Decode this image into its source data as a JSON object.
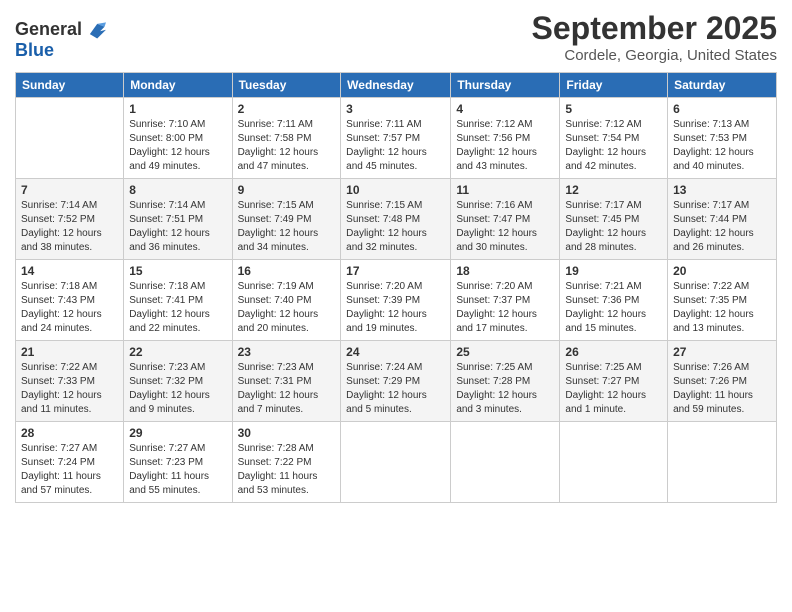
{
  "header": {
    "logo_general": "General",
    "logo_blue": "Blue",
    "month_title": "September 2025",
    "location": "Cordele, Georgia, United States"
  },
  "calendar": {
    "days_of_week": [
      "Sunday",
      "Monday",
      "Tuesday",
      "Wednesday",
      "Thursday",
      "Friday",
      "Saturday"
    ],
    "weeks": [
      [
        {
          "day": "",
          "info": ""
        },
        {
          "day": "1",
          "info": "Sunrise: 7:10 AM\nSunset: 8:00 PM\nDaylight: 12 hours\nand 49 minutes."
        },
        {
          "day": "2",
          "info": "Sunrise: 7:11 AM\nSunset: 7:58 PM\nDaylight: 12 hours\nand 47 minutes."
        },
        {
          "day": "3",
          "info": "Sunrise: 7:11 AM\nSunset: 7:57 PM\nDaylight: 12 hours\nand 45 minutes."
        },
        {
          "day": "4",
          "info": "Sunrise: 7:12 AM\nSunset: 7:56 PM\nDaylight: 12 hours\nand 43 minutes."
        },
        {
          "day": "5",
          "info": "Sunrise: 7:12 AM\nSunset: 7:54 PM\nDaylight: 12 hours\nand 42 minutes."
        },
        {
          "day": "6",
          "info": "Sunrise: 7:13 AM\nSunset: 7:53 PM\nDaylight: 12 hours\nand 40 minutes."
        }
      ],
      [
        {
          "day": "7",
          "info": "Sunrise: 7:14 AM\nSunset: 7:52 PM\nDaylight: 12 hours\nand 38 minutes."
        },
        {
          "day": "8",
          "info": "Sunrise: 7:14 AM\nSunset: 7:51 PM\nDaylight: 12 hours\nand 36 minutes."
        },
        {
          "day": "9",
          "info": "Sunrise: 7:15 AM\nSunset: 7:49 PM\nDaylight: 12 hours\nand 34 minutes."
        },
        {
          "day": "10",
          "info": "Sunrise: 7:15 AM\nSunset: 7:48 PM\nDaylight: 12 hours\nand 32 minutes."
        },
        {
          "day": "11",
          "info": "Sunrise: 7:16 AM\nSunset: 7:47 PM\nDaylight: 12 hours\nand 30 minutes."
        },
        {
          "day": "12",
          "info": "Sunrise: 7:17 AM\nSunset: 7:45 PM\nDaylight: 12 hours\nand 28 minutes."
        },
        {
          "day": "13",
          "info": "Sunrise: 7:17 AM\nSunset: 7:44 PM\nDaylight: 12 hours\nand 26 minutes."
        }
      ],
      [
        {
          "day": "14",
          "info": "Sunrise: 7:18 AM\nSunset: 7:43 PM\nDaylight: 12 hours\nand 24 minutes."
        },
        {
          "day": "15",
          "info": "Sunrise: 7:18 AM\nSunset: 7:41 PM\nDaylight: 12 hours\nand 22 minutes."
        },
        {
          "day": "16",
          "info": "Sunrise: 7:19 AM\nSunset: 7:40 PM\nDaylight: 12 hours\nand 20 minutes."
        },
        {
          "day": "17",
          "info": "Sunrise: 7:20 AM\nSunset: 7:39 PM\nDaylight: 12 hours\nand 19 minutes."
        },
        {
          "day": "18",
          "info": "Sunrise: 7:20 AM\nSunset: 7:37 PM\nDaylight: 12 hours\nand 17 minutes."
        },
        {
          "day": "19",
          "info": "Sunrise: 7:21 AM\nSunset: 7:36 PM\nDaylight: 12 hours\nand 15 minutes."
        },
        {
          "day": "20",
          "info": "Sunrise: 7:22 AM\nSunset: 7:35 PM\nDaylight: 12 hours\nand 13 minutes."
        }
      ],
      [
        {
          "day": "21",
          "info": "Sunrise: 7:22 AM\nSunset: 7:33 PM\nDaylight: 12 hours\nand 11 minutes."
        },
        {
          "day": "22",
          "info": "Sunrise: 7:23 AM\nSunset: 7:32 PM\nDaylight: 12 hours\nand 9 minutes."
        },
        {
          "day": "23",
          "info": "Sunrise: 7:23 AM\nSunset: 7:31 PM\nDaylight: 12 hours\nand 7 minutes."
        },
        {
          "day": "24",
          "info": "Sunrise: 7:24 AM\nSunset: 7:29 PM\nDaylight: 12 hours\nand 5 minutes."
        },
        {
          "day": "25",
          "info": "Sunrise: 7:25 AM\nSunset: 7:28 PM\nDaylight: 12 hours\nand 3 minutes."
        },
        {
          "day": "26",
          "info": "Sunrise: 7:25 AM\nSunset: 7:27 PM\nDaylight: 12 hours\nand 1 minute."
        },
        {
          "day": "27",
          "info": "Sunrise: 7:26 AM\nSunset: 7:26 PM\nDaylight: 11 hours\nand 59 minutes."
        }
      ],
      [
        {
          "day": "28",
          "info": "Sunrise: 7:27 AM\nSunset: 7:24 PM\nDaylight: 11 hours\nand 57 minutes."
        },
        {
          "day": "29",
          "info": "Sunrise: 7:27 AM\nSunset: 7:23 PM\nDaylight: 11 hours\nand 55 minutes."
        },
        {
          "day": "30",
          "info": "Sunrise: 7:28 AM\nSunset: 7:22 PM\nDaylight: 11 hours\nand 53 minutes."
        },
        {
          "day": "",
          "info": ""
        },
        {
          "day": "",
          "info": ""
        },
        {
          "day": "",
          "info": ""
        },
        {
          "day": "",
          "info": ""
        }
      ]
    ]
  }
}
